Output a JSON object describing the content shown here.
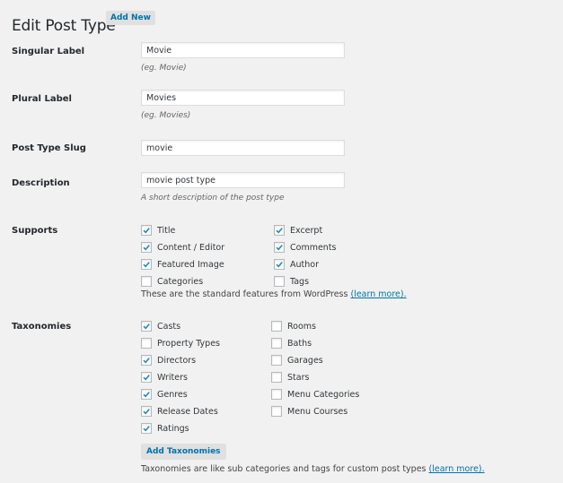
{
  "header": {
    "title": "Edit Post Type",
    "add_new_label": "Add New"
  },
  "fields": {
    "singular": {
      "label": "Singular Label",
      "value": "Movie",
      "hint": "(eg. Movie)"
    },
    "plural": {
      "label": "Plural Label",
      "value": "Movies",
      "hint": "(eg. Movies)"
    },
    "slug": {
      "label": "Post Type Slug",
      "value": "movie"
    },
    "description": {
      "label": "Description",
      "value": "movie post type",
      "hint": "A short description of the post type"
    }
  },
  "supports": {
    "label": "Supports",
    "items": [
      {
        "label": "Title",
        "checked": true
      },
      {
        "label": "Content / Editor",
        "checked": true
      },
      {
        "label": "Featured Image",
        "checked": true
      },
      {
        "label": "Categories",
        "checked": false
      },
      {
        "label": "Excerpt",
        "checked": true
      },
      {
        "label": "Comments",
        "checked": true
      },
      {
        "label": "Author",
        "checked": true
      },
      {
        "label": "Tags",
        "checked": false
      }
    ],
    "description": "These are the standard features from WordPress ",
    "learn_more": "(learn more)."
  },
  "taxonomies": {
    "label": "Taxonomies",
    "items": [
      {
        "label": "Casts",
        "checked": true
      },
      {
        "label": "Property Types",
        "checked": false
      },
      {
        "label": "Directors",
        "checked": true
      },
      {
        "label": "Writers",
        "checked": true
      },
      {
        "label": "Genres",
        "checked": true
      },
      {
        "label": "Release Dates",
        "checked": true
      },
      {
        "label": "Ratings",
        "checked": true
      },
      {
        "label": "Rooms",
        "checked": false
      },
      {
        "label": "Baths",
        "checked": false
      },
      {
        "label": "Garages",
        "checked": false
      },
      {
        "label": "Stars",
        "checked": false
      },
      {
        "label": "Menu Categories",
        "checked": false
      },
      {
        "label": "Menu Courses",
        "checked": false
      }
    ],
    "add_button_label": "Add Taxonomies",
    "description": "Taxonomies are like sub categories and tags for custom post types ",
    "learn_more": "(learn more)."
  },
  "colors": {
    "accent": "#0073aa",
    "checkmark": "#1e8cbe",
    "background": "#f1f1f1"
  }
}
